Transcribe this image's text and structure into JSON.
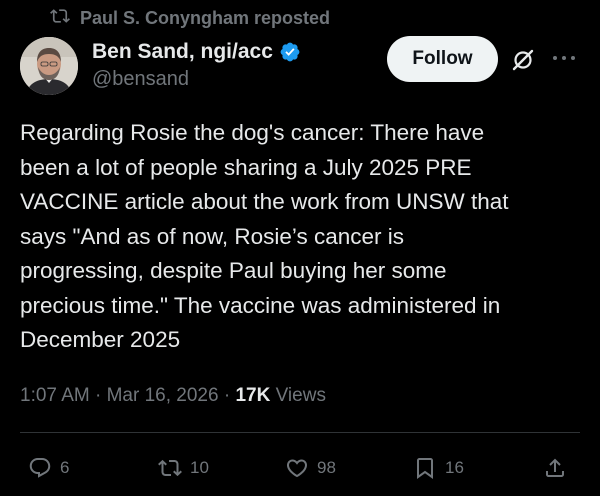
{
  "repost": {
    "text": "Paul S. Conyngham reposted",
    "icon": "repost-icon"
  },
  "author": {
    "display_name": "Ben Sand, ngi/acc",
    "handle": "@bensand",
    "verified_icon": "verified-badge-icon",
    "verified_color": "#1d9bf0"
  },
  "header_actions": {
    "follow_label": "Follow",
    "grok_icon": "grok-icon",
    "more_icon": "more-icon"
  },
  "tweet": {
    "text": "Regarding Rosie the dog's cancer: There have\nbeen a lot of people sharing a July 2025 PRE\nVACCINE article about the work from UNSW that\nsays \"And as of now, Rosie’s cancer is\nprogressing, despite Paul buying her some\nprecious time.\" The vaccine was administered in\nDecember 2025"
  },
  "meta": {
    "time": "1:07 AM",
    "separator": " · ",
    "date": "Mar 16, 2026",
    "views_count": "17K",
    "views_label": " Views"
  },
  "actions": {
    "replies": "6",
    "reposts": "10",
    "likes": "98",
    "bookmarks": "16"
  },
  "colors": {
    "background": "#000000",
    "text_primary": "#e7e9ea",
    "text_secondary": "#71767b",
    "follow_bg": "#eff3f4"
  }
}
